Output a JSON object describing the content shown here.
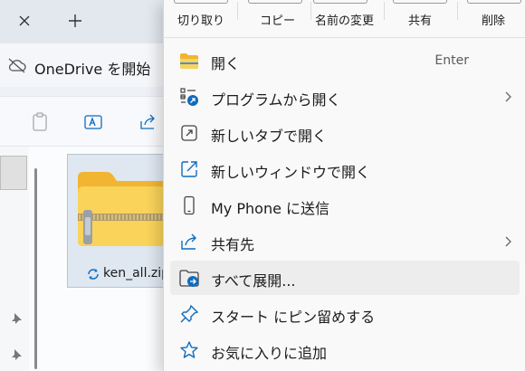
{
  "explorer": {
    "onedrive_label": "OneDrive を開始",
    "file_name": "ken_all.zip"
  },
  "context_menu": {
    "actions": [
      {
        "label": "切り取り",
        "icon": "cut-icon"
      },
      {
        "label": "コピー",
        "icon": "copy-icon"
      },
      {
        "label": "名前の変更",
        "icon": "rename-icon"
      },
      {
        "label": "共有",
        "icon": "share-icon"
      },
      {
        "label": "削除",
        "icon": "delete-icon"
      }
    ],
    "items": [
      {
        "label": "開く",
        "shortcut": "Enter",
        "icon": "folder-icon"
      },
      {
        "label": "プログラムから開く",
        "submenu": true,
        "icon": "open-with-icon"
      },
      {
        "label": "新しいタブで開く",
        "icon": "new-tab-icon"
      },
      {
        "label": "新しいウィンドウで開く",
        "icon": "new-window-icon"
      },
      {
        "label": "My Phone に送信",
        "icon": "phone-icon"
      },
      {
        "label": "共有先",
        "submenu": true,
        "icon": "share-icon"
      },
      {
        "label": "すべて展開...",
        "icon": "extract-all-icon",
        "highlighted": true
      },
      {
        "label": "スタート にピン留めする",
        "icon": "pin-icon"
      },
      {
        "label": "お気に入りに追加",
        "icon": "star-icon"
      }
    ]
  },
  "colors": {
    "accent": "#0f6cbd",
    "menu_background": "#f9f9f9",
    "hover_background": "#ededed",
    "folder_yellow": "#f7c948"
  }
}
